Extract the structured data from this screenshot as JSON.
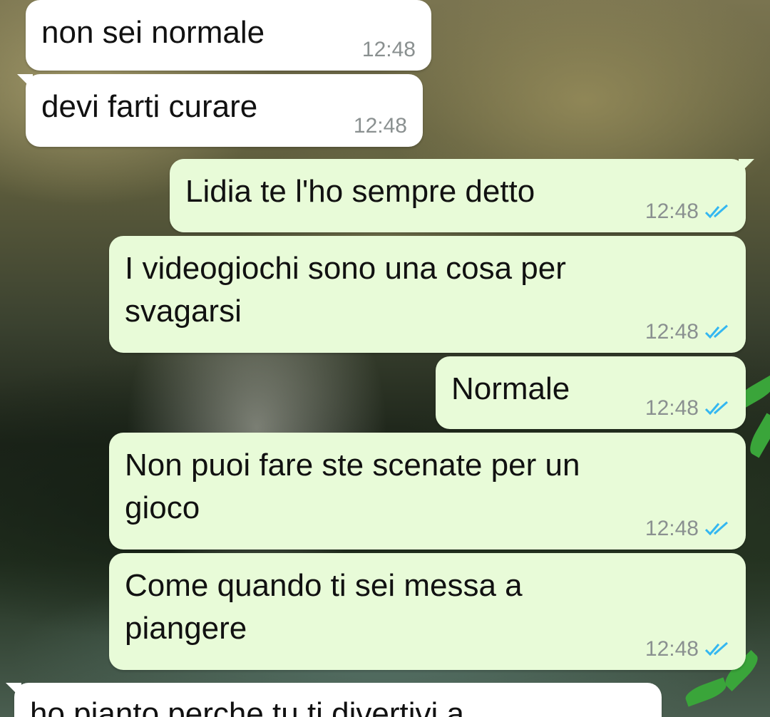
{
  "messages": [
    {
      "text": "non sei normale",
      "time": "12:48",
      "dir": "in"
    },
    {
      "text": "devi farti curare",
      "time": "12:48",
      "dir": "in"
    },
    {
      "text": "Lidia te l'ho sempre detto",
      "time": "12:48",
      "dir": "out",
      "status": "read-double-check-icon"
    },
    {
      "text": "I videogiochi sono una cosa per\nsvagarsi",
      "time": "12:48",
      "dir": "out",
      "status": "read-double-check-icon"
    },
    {
      "text": "Normale",
      "time": "12:48",
      "dir": "out",
      "status": "read-double-check-icon"
    },
    {
      "text": "Non puoi fare ste scenate per un\ngioco",
      "time": "12:48",
      "dir": "out",
      "status": "read-double-check-icon"
    },
    {
      "text": "Come quando ti sei messa a\npiangere",
      "time": "12:48",
      "dir": "out",
      "status": "read-double-check-icon"
    },
    {
      "text": "ho pianto perche tu ti divertivi a",
      "time": "",
      "dir": "in"
    }
  ],
  "colors": {
    "incoming_bubble": "#ffffff",
    "outgoing_bubble": "#e8fbd8",
    "read_tick": "#34b7f1",
    "timestamp": "#8a9090"
  }
}
